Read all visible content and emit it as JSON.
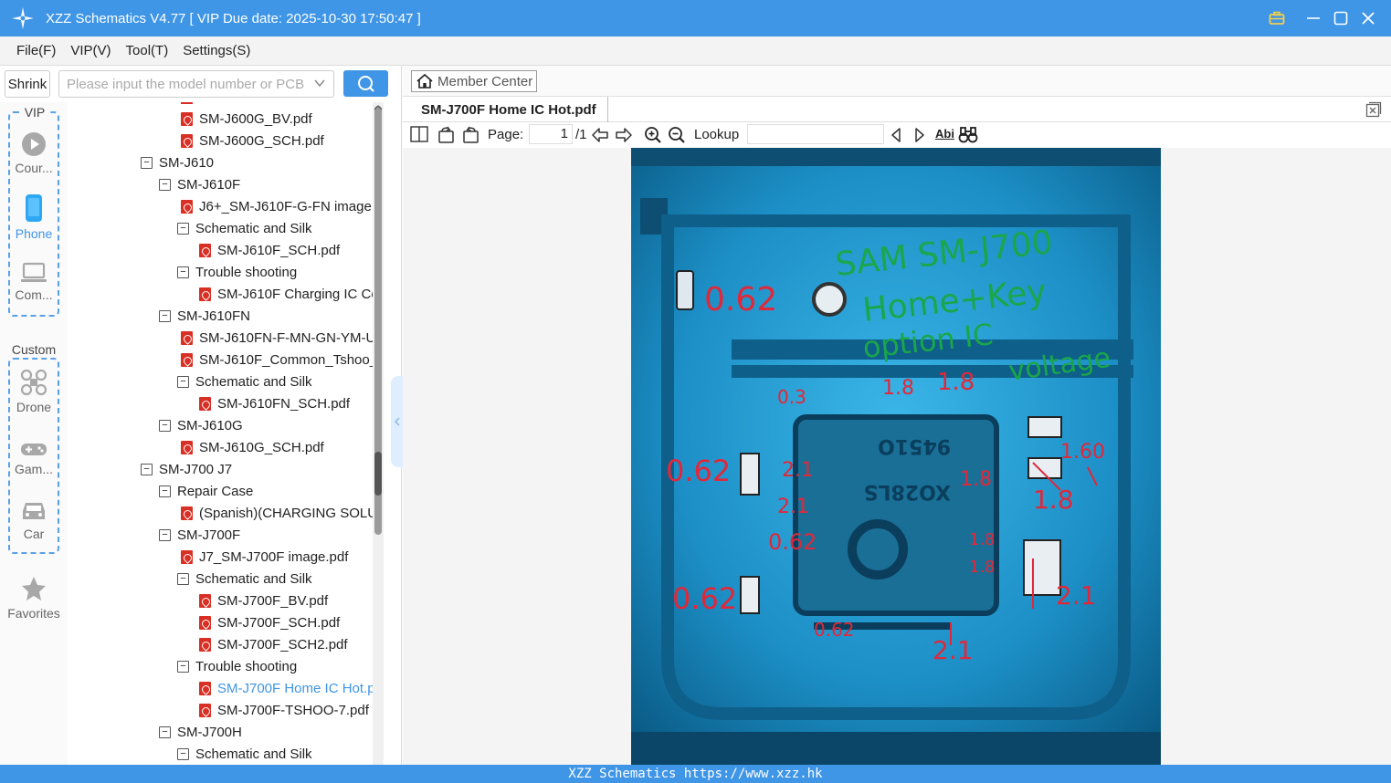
{
  "window": {
    "title": "XZZ Schematics V4.77 [ VIP Due date: 2025-10-30 17:50:47 ]"
  },
  "menu": [
    "File(F)",
    "VIP(V)",
    "Tool(T)",
    "Settings(S)"
  ],
  "search": {
    "shrink_label": "Shrink",
    "placeholder": "Please input the model number or PCB"
  },
  "rail": {
    "vip_label": "VIP",
    "custom_label": "Custom",
    "items": [
      {
        "label": "Cour...",
        "icon": "play-icon"
      },
      {
        "label": "Phone",
        "icon": "phone-icon"
      },
      {
        "label": "Com...",
        "icon": "laptop-icon"
      },
      {
        "label": "Drone",
        "icon": "drone-icon"
      },
      {
        "label": "Gam...",
        "icon": "gamepad-icon"
      },
      {
        "label": "Car",
        "icon": "car-icon"
      },
      {
        "label": "Favorites",
        "icon": "star-icon"
      }
    ]
  },
  "tree": [
    {
      "label": "SM-J600G_BV.pdf",
      "type": "pdf",
      "depth": 2
    },
    {
      "label": "SM-J600G_SCH.pdf",
      "type": "pdf",
      "depth": 2
    },
    {
      "label": "SM-J610",
      "type": "folder",
      "depth": 0
    },
    {
      "label": "SM-J610F",
      "type": "folder",
      "depth": 1
    },
    {
      "label": "J6+_SM-J610F-G-FN image.p",
      "type": "pdf",
      "depth": 2
    },
    {
      "label": "Schematic and Silk",
      "type": "folder",
      "depth": 2
    },
    {
      "label": "SM-J610F_SCH.pdf",
      "type": "pdf",
      "depth": 3
    },
    {
      "label": "Trouble shooting",
      "type": "folder",
      "depth": 2
    },
    {
      "label": "SM-J610F Charging IC Co",
      "type": "pdf",
      "depth": 3
    },
    {
      "label": "SM-J610FN",
      "type": "folder",
      "depth": 1
    },
    {
      "label": "SM-J610FN-F-MN-GN-YM-U",
      "type": "pdf",
      "depth": 2
    },
    {
      "label": "SM-J610F_Common_Tshoo_7",
      "type": "pdf",
      "depth": 2
    },
    {
      "label": "Schematic and Silk",
      "type": "folder",
      "depth": 2
    },
    {
      "label": "SM-J610FN_SCH.pdf",
      "type": "pdf",
      "depth": 3
    },
    {
      "label": "SM-J610G",
      "type": "folder",
      "depth": 1
    },
    {
      "label": "SM-J610G_SCH.pdf",
      "type": "pdf",
      "depth": 2
    },
    {
      "label": "SM-J700 J7",
      "type": "folder",
      "depth": 0
    },
    {
      "label": "Repair Case",
      "type": "folder",
      "depth": 1
    },
    {
      "label": "(Spanish)(CHARGING SOLUT",
      "type": "pdf",
      "depth": 2
    },
    {
      "label": "SM-J700F",
      "type": "folder",
      "depth": 1
    },
    {
      "label": "J7_SM-J700F image.pdf",
      "type": "pdf",
      "depth": 2
    },
    {
      "label": "Schematic and Silk",
      "type": "folder",
      "depth": 2
    },
    {
      "label": "SM-J700F_BV.pdf",
      "type": "pdf",
      "depth": 3
    },
    {
      "label": "SM-J700F_SCH.pdf",
      "type": "pdf",
      "depth": 3
    },
    {
      "label": "SM-J700F_SCH2.pdf",
      "type": "pdf",
      "depth": 3
    },
    {
      "label": "Trouble shooting",
      "type": "folder",
      "depth": 2
    },
    {
      "label": "SM-J700F Home IC Hot.p",
      "type": "pdf",
      "depth": 3,
      "selected": true
    },
    {
      "label": "SM-J700F-TSHOO-7.pdf",
      "type": "pdf",
      "depth": 3
    },
    {
      "label": "SM-J700H",
      "type": "folder",
      "depth": 1
    },
    {
      "label": "Schematic and Silk",
      "type": "folder",
      "depth": 2
    }
  ],
  "viewer": {
    "member_center": "Member Center",
    "tab_title": "SM-J700F Home IC Hot.pdf",
    "page_label": "Page:",
    "page_value": "1",
    "page_total": "/1",
    "lookup_label": "Lookup",
    "annotations": {
      "note_lines": [
        "SAM SM-J700",
        "Home+Key",
        "option IC",
        "voltage"
      ],
      "labels": [
        "0.62",
        "0.3",
        "1.8",
        "1.8",
        "0.62",
        "2.1",
        "2.1",
        "0.62",
        "1.8",
        "1.8",
        "1.8",
        "0.62",
        "1.8",
        "2.1",
        "0.62",
        "2.1",
        "1.60"
      ]
    }
  },
  "status": {
    "text": "XZZ Schematics https://www.xzz.hk"
  },
  "colors": {
    "accent": "#3f95e6",
    "pdf_red": "#d93025"
  }
}
